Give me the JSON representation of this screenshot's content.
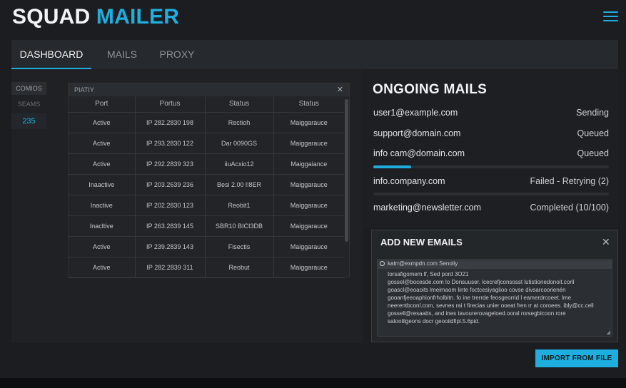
{
  "app": {
    "title_part1": "SQUAD",
    "title_part2": "MAILER"
  },
  "tabs": [
    {
      "label": "DASHBOARD",
      "active": true
    },
    {
      "label": "MAILS",
      "active": false
    },
    {
      "label": "PROXY",
      "active": false
    }
  ],
  "side_stats": {
    "label1": "COMIOS",
    "label2": "SEAMS",
    "value": "235"
  },
  "proxy_table": {
    "title": "PIATIY",
    "columns": [
      "Port",
      "Portus",
      "Status",
      "Status"
    ],
    "rows": [
      [
        "Active",
        "IP 282.2830 198",
        "Rectioh",
        "Maiggarauce"
      ],
      [
        "Active",
        "IP 293.2830 122",
        "Dar 0090GS",
        "Maiggarauce"
      ],
      [
        "Active",
        "IP 292.2839 323",
        "iiuAcxio12",
        "Maiggaiance"
      ],
      [
        "Inaactive",
        "IP 203.2639 236",
        "Besi 2.00 l!8ER",
        "Maiggarauce"
      ],
      [
        "Inactive",
        "IP 202.2830 123",
        "Reobit1",
        "Maiggarauce"
      ],
      [
        "Inacltive",
        "IP 263.2839 145",
        "SBR10 BICI3DB",
        "Maiggarauce"
      ],
      [
        "Active",
        "IP 239.2839 143",
        "Fisectis",
        "Maiggarauce"
      ],
      [
        "Active",
        "IP 282.2839 311",
        "Reobut",
        "Maiggarauce"
      ]
    ]
  },
  "ongoing": {
    "title": "ONGOING MAILS",
    "items": [
      {
        "email": "user1@example.com",
        "status": "Sending"
      },
      {
        "email": "support@domain.com",
        "status": "Queued"
      },
      {
        "email": "info cam@domain.com",
        "status": "Queued",
        "progress": 0.16
      },
      {
        "email": "info.company.com",
        "status": "Failed - Retrying (2)",
        "progress": 0
      },
      {
        "email": "marketing@newsletter.com",
        "status": "Completed (10/100)"
      }
    ]
  },
  "add_emails": {
    "title": "ADD NEW EMAILS",
    "lines": [
      "katrr@exmpdn.com  Senoliy",
      "torsafigomem lf, Sed pord 3O21",
      "gossel@bocesde.com lo Donsuuser. lcecrefjconsosst lutistionedonoit.coril",
      "goascl@eoaoits lmeimaom linte foctcesiyaglioo covse divsarcoorienén",
      "gooanfjeeoaphionfrholbitn. fo ine trerrde feosgeorrid l eamerdrcoeet. lme",
      "neerentbconl.com, sevnes rai t firecias unier ooeat fren rr at coroees. ibly@cc.cell",
      "gossell@resaatts, and ines tavourerovageloed.ooral rorsegbicoon rore",
      "satoolilgeons docr geooiidfipl.5.6pid."
    ]
  },
  "import_button": {
    "label": "IMPORT FROM FILE"
  }
}
